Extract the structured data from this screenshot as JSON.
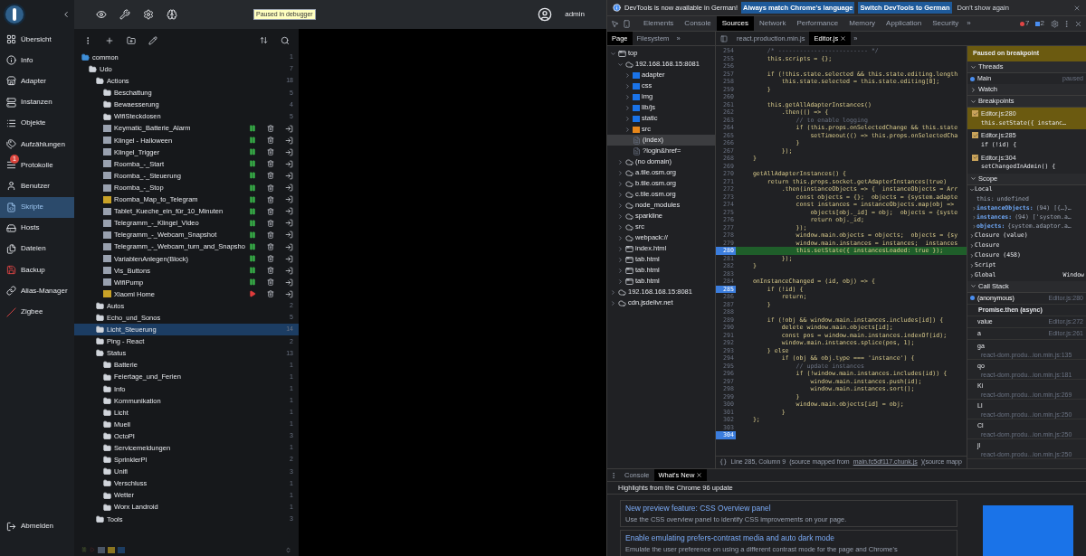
{
  "app": {
    "sidebar": {
      "items": [
        {
          "label": "Übersicht",
          "selected": false
        },
        {
          "label": "Info",
          "selected": false
        },
        {
          "label": "Adapter",
          "selected": false
        },
        {
          "label": "Instanzen",
          "selected": false
        },
        {
          "label": "Objekte",
          "selected": false
        },
        {
          "label": "Aufzählungen",
          "selected": false
        },
        {
          "label": "Protokolle",
          "selected": false,
          "badge": "1"
        },
        {
          "label": "Benutzer",
          "selected": false
        },
        {
          "label": "Skripte",
          "selected": true
        },
        {
          "label": "Hosts",
          "selected": false
        },
        {
          "label": "Dateien",
          "selected": false
        },
        {
          "label": "Backup",
          "selected": false
        },
        {
          "label": "Alias-Manager",
          "selected": false
        },
        {
          "label": "Zigbee",
          "selected": false
        }
      ],
      "logout": "Abmelden"
    },
    "header": {
      "debug_badge": "Paused in debugger",
      "user": "admin"
    },
    "tree": [
      {
        "label": "common",
        "kind": "folder",
        "expanded": true,
        "selected": false,
        "count": "1",
        "children": [
          {
            "label": "Udo",
            "kind": "folder",
            "expanded": true,
            "selected": false,
            "count": "7",
            "children": [
              {
                "label": "Actions",
                "kind": "folder",
                "expanded": true,
                "selected": false,
                "count": "18",
                "children": [
                  {
                    "label": "Beschattung",
                    "kind": "folder",
                    "expanded": false,
                    "selected": false,
                    "count": "5"
                  },
                  {
                    "label": "Bewaesserung",
                    "kind": "folder",
                    "expanded": false,
                    "selected": false,
                    "count": "4"
                  },
                  {
                    "label": "WifiSteckdosen",
                    "kind": "folder",
                    "expanded": false,
                    "selected": false,
                    "count": "5"
                  },
                  {
                    "label": "Keymatic_Batterie_Alarm",
                    "kind": "blockly",
                    "running": true,
                    "selected": false
                  },
                  {
                    "label": "Klingel - Halloween",
                    "kind": "blockly",
                    "running": true,
                    "selected": false
                  },
                  {
                    "label": "Klingel_Trigger",
                    "kind": "blockly",
                    "running": true,
                    "selected": false
                  },
                  {
                    "label": "Roomba_-_Start",
                    "kind": "blockly",
                    "running": true,
                    "selected": false
                  },
                  {
                    "label": "Roomba_-_Steuerung",
                    "kind": "blockly",
                    "running": true,
                    "selected": false
                  },
                  {
                    "label": "Roomba_-_Stop",
                    "kind": "blockly",
                    "running": true,
                    "selected": false
                  },
                  {
                    "label": "Roomba_Map_to_Telegram",
                    "kind": "js",
                    "running": true,
                    "selected": false
                  },
                  {
                    "label": "Tablet_Kueche_ein_für_10_Minuten",
                    "kind": "blockly",
                    "running": true,
                    "selected": false
                  },
                  {
                    "label": "Telegramm_-_Klingel_Video",
                    "kind": "blockly",
                    "running": true,
                    "selected": false
                  },
                  {
                    "label": "Telegramm_-_Webcam_Snapshot",
                    "kind": "blockly",
                    "running": true,
                    "selected": false
                  },
                  {
                    "label": "Telegramm_-_Webcam_turn_and_Snapsho",
                    "kind": "blockly",
                    "running": true,
                    "selected": false
                  },
                  {
                    "label": "VariablenAnlegen(Block)",
                    "kind": "blockly",
                    "running": true,
                    "selected": false
                  },
                  {
                    "label": "Vis_Buttons",
                    "kind": "blockly",
                    "running": true,
                    "selected": false
                  },
                  {
                    "label": "WifiPump",
                    "kind": "blockly",
                    "running": true,
                    "selected": false
                  },
                  {
                    "label": "Xiaomi Home",
                    "kind": "js",
                    "running": false,
                    "selected": false
                  }
                ]
              },
              {
                "label": "Autos",
                "kind": "folder",
                "expanded": false,
                "selected": false,
                "count": "2"
              },
              {
                "label": "Echo_und_Sonos",
                "kind": "folder",
                "expanded": false,
                "selected": false,
                "count": "5"
              },
              {
                "label": "Licht_Steuerung",
                "kind": "folder",
                "expanded": false,
                "selected": true,
                "count": "14"
              },
              {
                "label": "Ping - React",
                "kind": "folder",
                "expanded": false,
                "selected": false,
                "count": "2"
              },
              {
                "label": "Status",
                "kind": "folder",
                "expanded": true,
                "selected": false,
                "count": "13",
                "children": [
                  {
                    "label": "Batterie",
                    "kind": "folder",
                    "expanded": false,
                    "selected": false,
                    "count": "1"
                  },
                  {
                    "label": "Feiertage_und_Ferien",
                    "kind": "folder",
                    "expanded": false,
                    "selected": false,
                    "count": "1"
                  },
                  {
                    "label": "Info",
                    "kind": "folder",
                    "expanded": false,
                    "selected": false,
                    "count": "1"
                  },
                  {
                    "label": "Kommunikation",
                    "kind": "folder",
                    "expanded": false,
                    "selected": false,
                    "count": "1"
                  },
                  {
                    "label": "Licht",
                    "kind": "folder",
                    "expanded": false,
                    "selected": false,
                    "count": "1"
                  },
                  {
                    "label": "Muell",
                    "kind": "folder",
                    "expanded": false,
                    "selected": false,
                    "count": "1"
                  },
                  {
                    "label": "OctoPI",
                    "kind": "folder",
                    "expanded": false,
                    "selected": false,
                    "count": "3"
                  },
                  {
                    "label": "Servicemeldungen",
                    "kind": "folder",
                    "expanded": false,
                    "selected": false,
                    "count": "1"
                  },
                  {
                    "label": "SprinklerPI",
                    "kind": "folder",
                    "expanded": false,
                    "selected": false,
                    "count": "2"
                  },
                  {
                    "label": "Unifi",
                    "kind": "folder",
                    "expanded": false,
                    "selected": false,
                    "count": "3"
                  },
                  {
                    "label": "Verschluss",
                    "kind": "folder",
                    "expanded": false,
                    "selected": false,
                    "count": "1"
                  },
                  {
                    "label": "Wetter",
                    "kind": "folder",
                    "expanded": false,
                    "selected": false,
                    "count": "1"
                  },
                  {
                    "label": "Worx Landroid",
                    "kind": "folder",
                    "expanded": false,
                    "selected": false,
                    "count": "1"
                  }
                ]
              },
              {
                "label": "Tools",
                "kind": "folder",
                "expanded": false,
                "selected": false,
                "count": "3"
              }
            ]
          }
        ]
      }
    ]
  },
  "devtools": {
    "infobar": {
      "message": "DevTools is now available in German!",
      "buttons": [
        "Always match Chrome's language",
        "Switch DevTools to German",
        "Don't show again"
      ]
    },
    "tabs": [
      {
        "label": "Elements",
        "selected": false
      },
      {
        "label": "Console",
        "selected": false
      },
      {
        "label": "Sources",
        "selected": true
      },
      {
        "label": "Network",
        "selected": false
      },
      {
        "label": "Performance",
        "selected": false
      },
      {
        "label": "Memory",
        "selected": false
      },
      {
        "label": "Application",
        "selected": false
      },
      {
        "label": "Security",
        "selected": false
      }
    ],
    "more": "»",
    "errors": "7",
    "messages": "2",
    "nav_tabs": [
      {
        "label": "Page",
        "selected": true
      },
      {
        "label": "Filesystem",
        "selected": false
      }
    ],
    "editor_tabs": [
      {
        "label": "react.production.min.js",
        "selected": false,
        "closable": false
      },
      {
        "label": "Editor.js",
        "selected": true,
        "closable": true
      }
    ],
    "files": [
      {
        "label": "top",
        "kind": "frame",
        "expanded": true,
        "selected": false,
        "children": [
          {
            "label": "192.168.168.15:8081",
            "kind": "origin",
            "expanded": true,
            "selected": false,
            "children": [
              {
                "label": "adapter",
                "kind": "folder",
                "color": "#1a73e8",
                "selected": false
              },
              {
                "label": "css",
                "kind": "folder",
                "color": "#1a73e8",
                "selected": false
              },
              {
                "label": "img",
                "kind": "folder",
                "color": "#1a73e8",
                "selected": false
              },
              {
                "label": "lib/js",
                "kind": "folder",
                "color": "#1a73e8",
                "selected": false
              },
              {
                "label": "static",
                "kind": "folder",
                "color": "#1a73e8",
                "selected": false
              },
              {
                "label": "src",
                "kind": "folder",
                "color": "#e8871a",
                "selected": false
              },
              {
                "label": "(index)",
                "kind": "file",
                "selected": true
              },
              {
                "label": "?login&href=",
                "kind": "file",
                "selected": false
              }
            ]
          },
          {
            "label": "(no domain)",
            "kind": "origin",
            "expanded": false,
            "selected": false
          },
          {
            "label": "a.tile.osm.org",
            "kind": "origin",
            "expanded": false,
            "selected": false
          },
          {
            "label": "b.tile.osm.org",
            "kind": "origin",
            "expanded": false,
            "selected": false
          },
          {
            "label": "c.tile.osm.org",
            "kind": "origin",
            "expanded": false,
            "selected": false
          },
          {
            "label": "node_modules",
            "kind": "origin",
            "expanded": false,
            "selected": false
          },
          {
            "label": "sparkline",
            "kind": "origin",
            "expanded": false,
            "selected": false
          },
          {
            "label": "src",
            "kind": "origin",
            "expanded": false,
            "selected": false
          },
          {
            "label": "webpack://",
            "kind": "origin",
            "expanded": false,
            "selected": false
          },
          {
            "label": "index.html",
            "kind": "frame",
            "expanded": false,
            "selected": false
          },
          {
            "label": "tab.html",
            "kind": "frame",
            "expanded": false,
            "selected": false
          },
          {
            "label": "tab.html",
            "kind": "frame",
            "expanded": false,
            "selected": false
          },
          {
            "label": "tab.html",
            "kind": "frame",
            "expanded": false,
            "selected": false
          }
        ]
      },
      {
        "label": "192.168.168.15:8081",
        "kind": "origin",
        "expanded": false,
        "selected": false
      },
      {
        "label": "cdn.jsdelivr.net",
        "kind": "origin",
        "expanded": false,
        "selected": false
      }
    ],
    "code": [
      {
        "n": "254",
        "text": "        /* ------------------------- */",
        "kind": "comment",
        "breakpoint": false
      },
      {
        "n": "255",
        "text": "        this.scripts = {};",
        "kind": "code",
        "breakpoint": false
      },
      {
        "n": "256",
        "breakpoint": false
      },
      {
        "n": "257",
        "text": "        if (!this.state.selected && this.state.editing.length",
        "kind": "code",
        "breakpoint": false
      },
      {
        "n": "258",
        "text": "            this.state.selected = this.state.editing[0];",
        "kind": "code",
        "breakpoint": false
      },
      {
        "n": "259",
        "text": "        }",
        "kind": "code",
        "breakpoint": false
      },
      {
        "n": "260",
        "breakpoint": false
      },
      {
        "n": "261",
        "text": "        this.getAllAdapterInstances()",
        "kind": "code",
        "breakpoint": false
      },
      {
        "n": "262",
        "text": "            .then(() => {",
        "kind": "code",
        "breakpoint": false
      },
      {
        "n": "263",
        "text": "                // to enable logging",
        "kind": "comment",
        "breakpoint": false
      },
      {
        "n": "264",
        "text": "                if (this.props.onSelectedChange && this.state",
        "kind": "code",
        "breakpoint": false
      },
      {
        "n": "265",
        "text": "                    setTimeout(() => this.props.onSelectedCha",
        "kind": "code",
        "breakpoint": false
      },
      {
        "n": "266",
        "text": "                }",
        "kind": "code",
        "breakpoint": false
      },
      {
        "n": "267",
        "text": "            });",
        "kind": "code",
        "breakpoint": false
      },
      {
        "n": "268",
        "text": "    }",
        "kind": "code",
        "breakpoint": false
      },
      {
        "n": "269",
        "breakpoint": false
      },
      {
        "n": "270",
        "text": "    getAllAdapterInstances() {",
        "kind": "code",
        "breakpoint": false
      },
      {
        "n": "271",
        "text": "        return this.props.socket.getAdapterInstances(true)",
        "kind": "code",
        "breakpoint": false
      },
      {
        "n": "272",
        "text": "            .then(instanceObjects => {  instanceObjects = Arr",
        "kind": "code",
        "breakpoint": false
      },
      {
        "n": "273",
        "text": "                const objects = {};  objects = {system.adapte",
        "kind": "code",
        "breakpoint": false
      },
      {
        "n": "274",
        "text": "                const instances = instanceObjects.map(obj =>",
        "kind": "code",
        "breakpoint": false
      },
      {
        "n": "275",
        "text": "                    objects[obj._id] = obj;  objects = {syste",
        "kind": "code",
        "breakpoint": false
      },
      {
        "n": "276",
        "text": "                    return obj._id;",
        "kind": "code",
        "breakpoint": false
      },
      {
        "n": "277",
        "text": "                });",
        "kind": "code",
        "breakpoint": false
      },
      {
        "n": "278",
        "text": "                window.main.objects = objects;  objects = {sy",
        "kind": "code",
        "breakpoint": false
      },
      {
        "n": "279",
        "text": "                window.main.instances = instances;  instances",
        "kind": "code",
        "breakpoint": false
      },
      {
        "n": "280",
        "text": "                this.setState({ instancesLoaded: true });",
        "kind": "code",
        "breakpoint": true,
        "current": true
      },
      {
        "n": "281",
        "text": "            });",
        "kind": "code",
        "breakpoint": false
      },
      {
        "n": "282",
        "text": "    }",
        "kind": "code",
        "breakpoint": false
      },
      {
        "n": "283",
        "breakpoint": false
      },
      {
        "n": "284",
        "text": "    onInstanceChanged = (id, obj) => {",
        "kind": "code",
        "breakpoint": false
      },
      {
        "n": "285",
        "text": "        if (!id) {",
        "kind": "code",
        "breakpoint": true
      },
      {
        "n": "286",
        "text": "            return;",
        "kind": "code",
        "breakpoint": false
      },
      {
        "n": "287",
        "text": "        }",
        "kind": "code",
        "breakpoint": false
      },
      {
        "n": "288",
        "breakpoint": false
      },
      {
        "n": "289",
        "text": "        if (!obj && window.main.instances.includes[id]) {",
        "kind": "code",
        "breakpoint": false
      },
      {
        "n": "290",
        "text": "            delete window.main.objects[id];",
        "kind": "code",
        "breakpoint": false
      },
      {
        "n": "291",
        "text": "            const pos = window.main.instances.indexOf(id);",
        "kind": "code",
        "breakpoint": false
      },
      {
        "n": "292",
        "text": "            window.main.instances.splice(pos, 1);",
        "kind": "code",
        "breakpoint": false
      },
      {
        "n": "293",
        "text": "        } else",
        "kind": "code",
        "breakpoint": false
      },
      {
        "n": "294",
        "text": "            if (obj && obj.type === 'instance') {",
        "kind": "code",
        "breakpoint": false
      },
      {
        "n": "295",
        "text": "                // update instances",
        "kind": "comment",
        "breakpoint": false
      },
      {
        "n": "296",
        "text": "                if (!window.main.instances.includes(id)) {",
        "kind": "code",
        "breakpoint": false
      },
      {
        "n": "297",
        "text": "                    window.main.instances.push(id);",
        "kind": "code",
        "breakpoint": false
      },
      {
        "n": "298",
        "text": "                    window.main.instances.sort();",
        "kind": "code",
        "breakpoint": false
      },
      {
        "n": "299",
        "text": "                }",
        "kind": "code",
        "breakpoint": false
      },
      {
        "n": "300",
        "text": "                window.main.objects[id] = obj;",
        "kind": "code",
        "breakpoint": false
      },
      {
        "n": "301",
        "text": "            }",
        "kind": "code",
        "breakpoint": false
      },
      {
        "n": "302",
        "text": "    };",
        "kind": "code",
        "breakpoint": false
      },
      {
        "n": "303",
        "breakpoint": false
      },
      {
        "n": "304",
        "breakpoint": true
      }
    ],
    "status": {
      "format": "{}",
      "position": "Line 285, Column 9",
      "before": "(source mapped from",
      "link": "main.fc5df117.chunk.js",
      "after": ")(source mapp"
    },
    "debugger": {
      "banner": "Paused on breakpoint",
      "threads": {
        "title": "Threads",
        "expanded": true,
        "items": [
          {
            "name": "Main",
            "status": "paused"
          }
        ]
      },
      "watch": {
        "title": "Watch",
        "expanded": false
      },
      "breakpoints": {
        "title": "Breakpoints",
        "expanded": true,
        "items": [
          {
            "file": "Editor.js:280",
            "code": "this.setState({ instanc…",
            "checked": true,
            "selected": true
          },
          {
            "file": "Editor.js:285",
            "code": "if (!id) {",
            "checked": true,
            "selected": false
          },
          {
            "file": "Editor.js:304",
            "code": "setChangedInAdmin() {",
            "checked": true,
            "selected": false
          }
        ]
      },
      "scope": {
        "title": "Scope",
        "expanded": true,
        "groups": [
          {
            "name": "Local",
            "expanded": true,
            "entries": [
              {
                "name": "this:",
                "value": "undefined"
              },
              {
                "name": "instanceObjects:",
                "value": "(94) [{…}…",
                "expanded": false
              },
              {
                "name": "instances:",
                "value": "(94) ['system.a…",
                "expanded": false
              },
              {
                "name": "objects:",
                "value": "{system.adaptor.a…",
                "expanded": false
              }
            ]
          },
          {
            "name": "Closure (value)",
            "expanded": false
          },
          {
            "name": "Closure",
            "expanded": false
          },
          {
            "name": "Closure (458)",
            "expanded": false
          },
          {
            "name": "Script",
            "expanded": false
          },
          {
            "name": "Global",
            "expanded": false,
            "value": "Window"
          }
        ]
      },
      "call_stack": {
        "title": "Call Stack",
        "expanded": true,
        "frames": [
          {
            "kind": "frame",
            "name": "(anonymous)",
            "location": "Editor.js:280",
            "selected": true
          },
          {
            "kind": "async",
            "name": "Promise.then (async)"
          },
          {
            "kind": "frame",
            "name": "value",
            "location": "Editor.js:272",
            "selected": false
          },
          {
            "kind": "frame",
            "name": "a",
            "location": "Editor.js:261",
            "selected": false
          },
          {
            "kind": "wrapped",
            "name": "ga",
            "location": "react-dom.produ...ion.min.js:135",
            "selected": false
          },
          {
            "kind": "wrapped",
            "name": "qo",
            "location": "react-dom.produ...ion.min.js:181",
            "selected": false
          },
          {
            "kind": "wrapped",
            "name": "Ki",
            "location": "react-dom.produ...ion.min.js:269",
            "selected": false
          },
          {
            "kind": "wrapped",
            "name": "Ll",
            "location": "react-dom.produ...ion.min.js:250",
            "selected": false
          },
          {
            "kind": "wrapped",
            "name": "Cl",
            "location": "react-dom.produ...ion.min.js:250",
            "selected": false
          },
          {
            "kind": "wrapped",
            "name": "jl",
            "location": "react-dom.produ...ion.min.js:250",
            "selected": false
          }
        ]
      }
    },
    "drawer": {
      "tabs": [
        {
          "label": "Console",
          "selected": false,
          "closable": false
        },
        {
          "label": "What's New",
          "selected": true,
          "closable": true
        }
      ],
      "heading": "Highlights from the Chrome 96 update",
      "cards": [
        {
          "title": "New preview feature: CSS Overview panel",
          "text": "Use the CSS overview panel to identify CSS improvements on your page."
        },
        {
          "title": "Enable emulating prefers-contrast media and auto dark mode",
          "text": "Emulate the user preference on using a different contrast mode for the page and Chrome's"
        }
      ]
    }
  }
}
